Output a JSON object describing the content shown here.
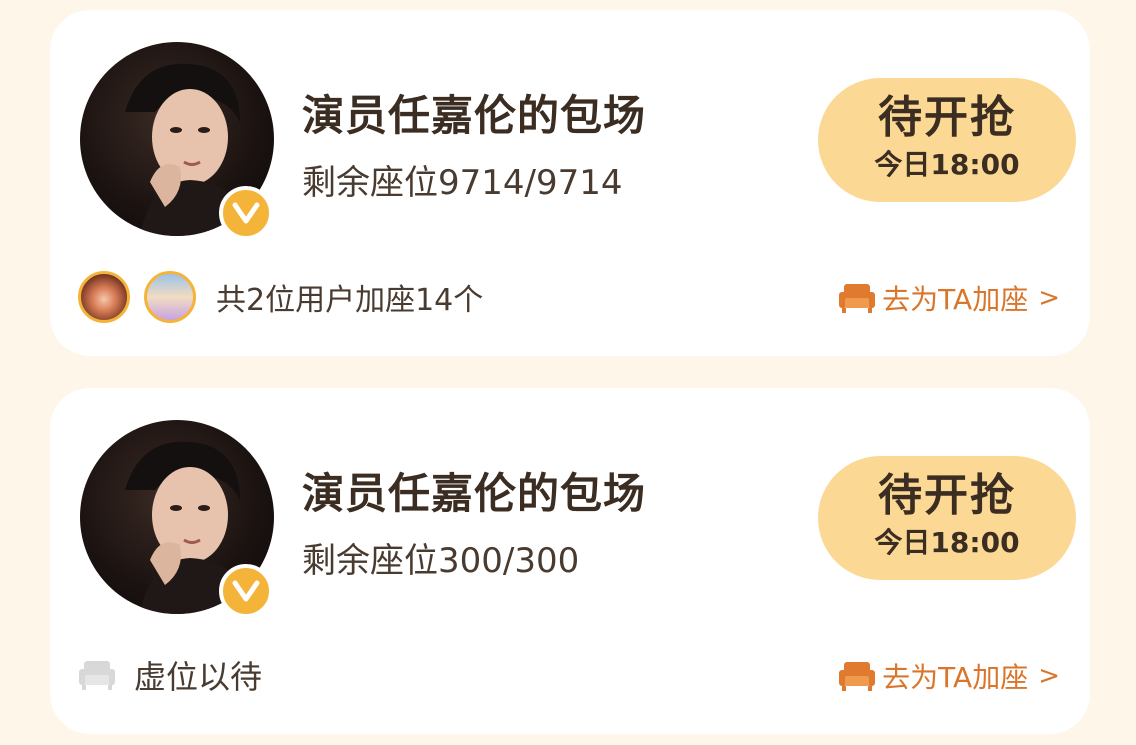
{
  "cards": [
    {
      "title": "演员任嘉伦的包场",
      "seats": "剩余座位9714/9714",
      "grab_label": "待开抢",
      "grab_time": "今日18:00",
      "joined_text": "共2位用户加座14个",
      "add_seat_label": "去为TA加座",
      "add_seat_chevron": ">"
    },
    {
      "title": "演员任嘉伦的包场",
      "seats": "剩余座位300/300",
      "grab_label": "待开抢",
      "grab_time": "今日18:00",
      "empty_text": "虚位以待",
      "add_seat_label": "去为TA加座",
      "add_seat_chevron": ">"
    }
  ],
  "colors": {
    "background": "#FDF6E9",
    "card": "#FFFFFF",
    "accent_button": "#FBD994",
    "badge": "#F4B43A",
    "link": "#D9762B",
    "text": "#3B2D22"
  },
  "icons": {
    "verified": "verified-v-icon",
    "sofa": "sofa-icon",
    "empty_seat": "empty-seat-icon"
  }
}
